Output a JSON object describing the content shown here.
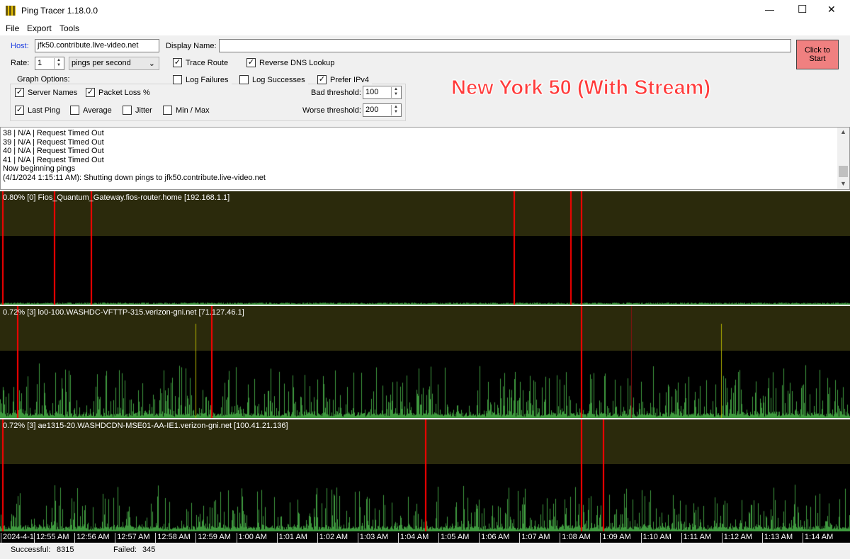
{
  "window": {
    "title": "Ping Tracer 1.18.0.0",
    "minimize": "—",
    "maximize": "☐",
    "close": "✕"
  },
  "menu": [
    "File",
    "Export",
    "Tools"
  ],
  "form": {
    "host_label": "Host:",
    "host_value": "jfk50.contribute.live-video.net",
    "display_name_label": "Display Name:",
    "display_name_value": "",
    "rate_label": "Rate:",
    "rate_value": "1",
    "rate_unit": "pings per second",
    "trace_route": "Trace Route",
    "reverse_dns": "Reverse DNS Lookup",
    "log_failures": "Log Failures",
    "log_successes": "Log Successes",
    "prefer_ipv4": "Prefer IPv4",
    "graph_options": "Graph Options:",
    "server_names": "Server Names",
    "packet_loss": "Packet Loss %",
    "last_ping": "Last Ping",
    "average": "Average",
    "jitter": "Jitter",
    "min_max": "Min / Max",
    "bad_threshold_label": "Bad threshold:",
    "bad_threshold": "100",
    "worse_threshold_label": "Worse threshold:",
    "worse_threshold": "200",
    "start_button": "Click to Start",
    "checked": {
      "trace_route": true,
      "reverse_dns": true,
      "log_failures": false,
      "log_successes": false,
      "prefer_ipv4": true,
      "server_names": true,
      "packet_loss": true,
      "last_ping": true,
      "average": false,
      "jitter": false,
      "min_max": false
    }
  },
  "overlay_title": "New York 50 (With Stream)",
  "log": [
    "38 | N/A | Request Timed Out",
    "39 | N/A | Request Timed Out",
    "40 | N/A | Request Timed Out",
    "41 | N/A | Request Timed Out",
    "Now beginning pings",
    "(4/1/2024 1:15:11 AM): Shutting down pings to jfk50.contribute.live-video.net"
  ],
  "graphs": [
    {
      "label": "0.80% [0] Fios_Quantum_Gateway.fios-router.home [192.168.1.1]"
    },
    {
      "label": "0.72% [3] lo0-100.WASHDC-VFTTP-315.verizon-gni.net [71.127.46.1]"
    },
    {
      "label": "0.72% [3] ae1315-20.WASHDCDN-MSE01-AA-IE1.verizon-gni.net [100.41.21.136]"
    }
  ],
  "time_axis": [
    "2024-4-1",
    "12:55 AM",
    "12:56 AM",
    "12:57 AM",
    "12:58 AM",
    "12:59 AM",
    "1:00 AM",
    "1:01 AM",
    "1:02 AM",
    "1:03 AM",
    "1:04 AM",
    "1:05 AM",
    "1:06 AM",
    "1:07 AM",
    "1:08 AM",
    "1:09 AM",
    "1:10 AM",
    "1:11 AM",
    "1:12 AM",
    "1:13 AM",
    "1:14 AM"
  ],
  "status": {
    "successful_label": "Successful:",
    "successful": "8315",
    "failed_label": "Failed:",
    "failed": "345"
  },
  "colors": {
    "success": "#3f9a3f",
    "failure": "#ff0000",
    "bad": "#b0b000",
    "band": "#2b2a0c",
    "start_button": "#f08080",
    "title": "#ff3b3b"
  }
}
